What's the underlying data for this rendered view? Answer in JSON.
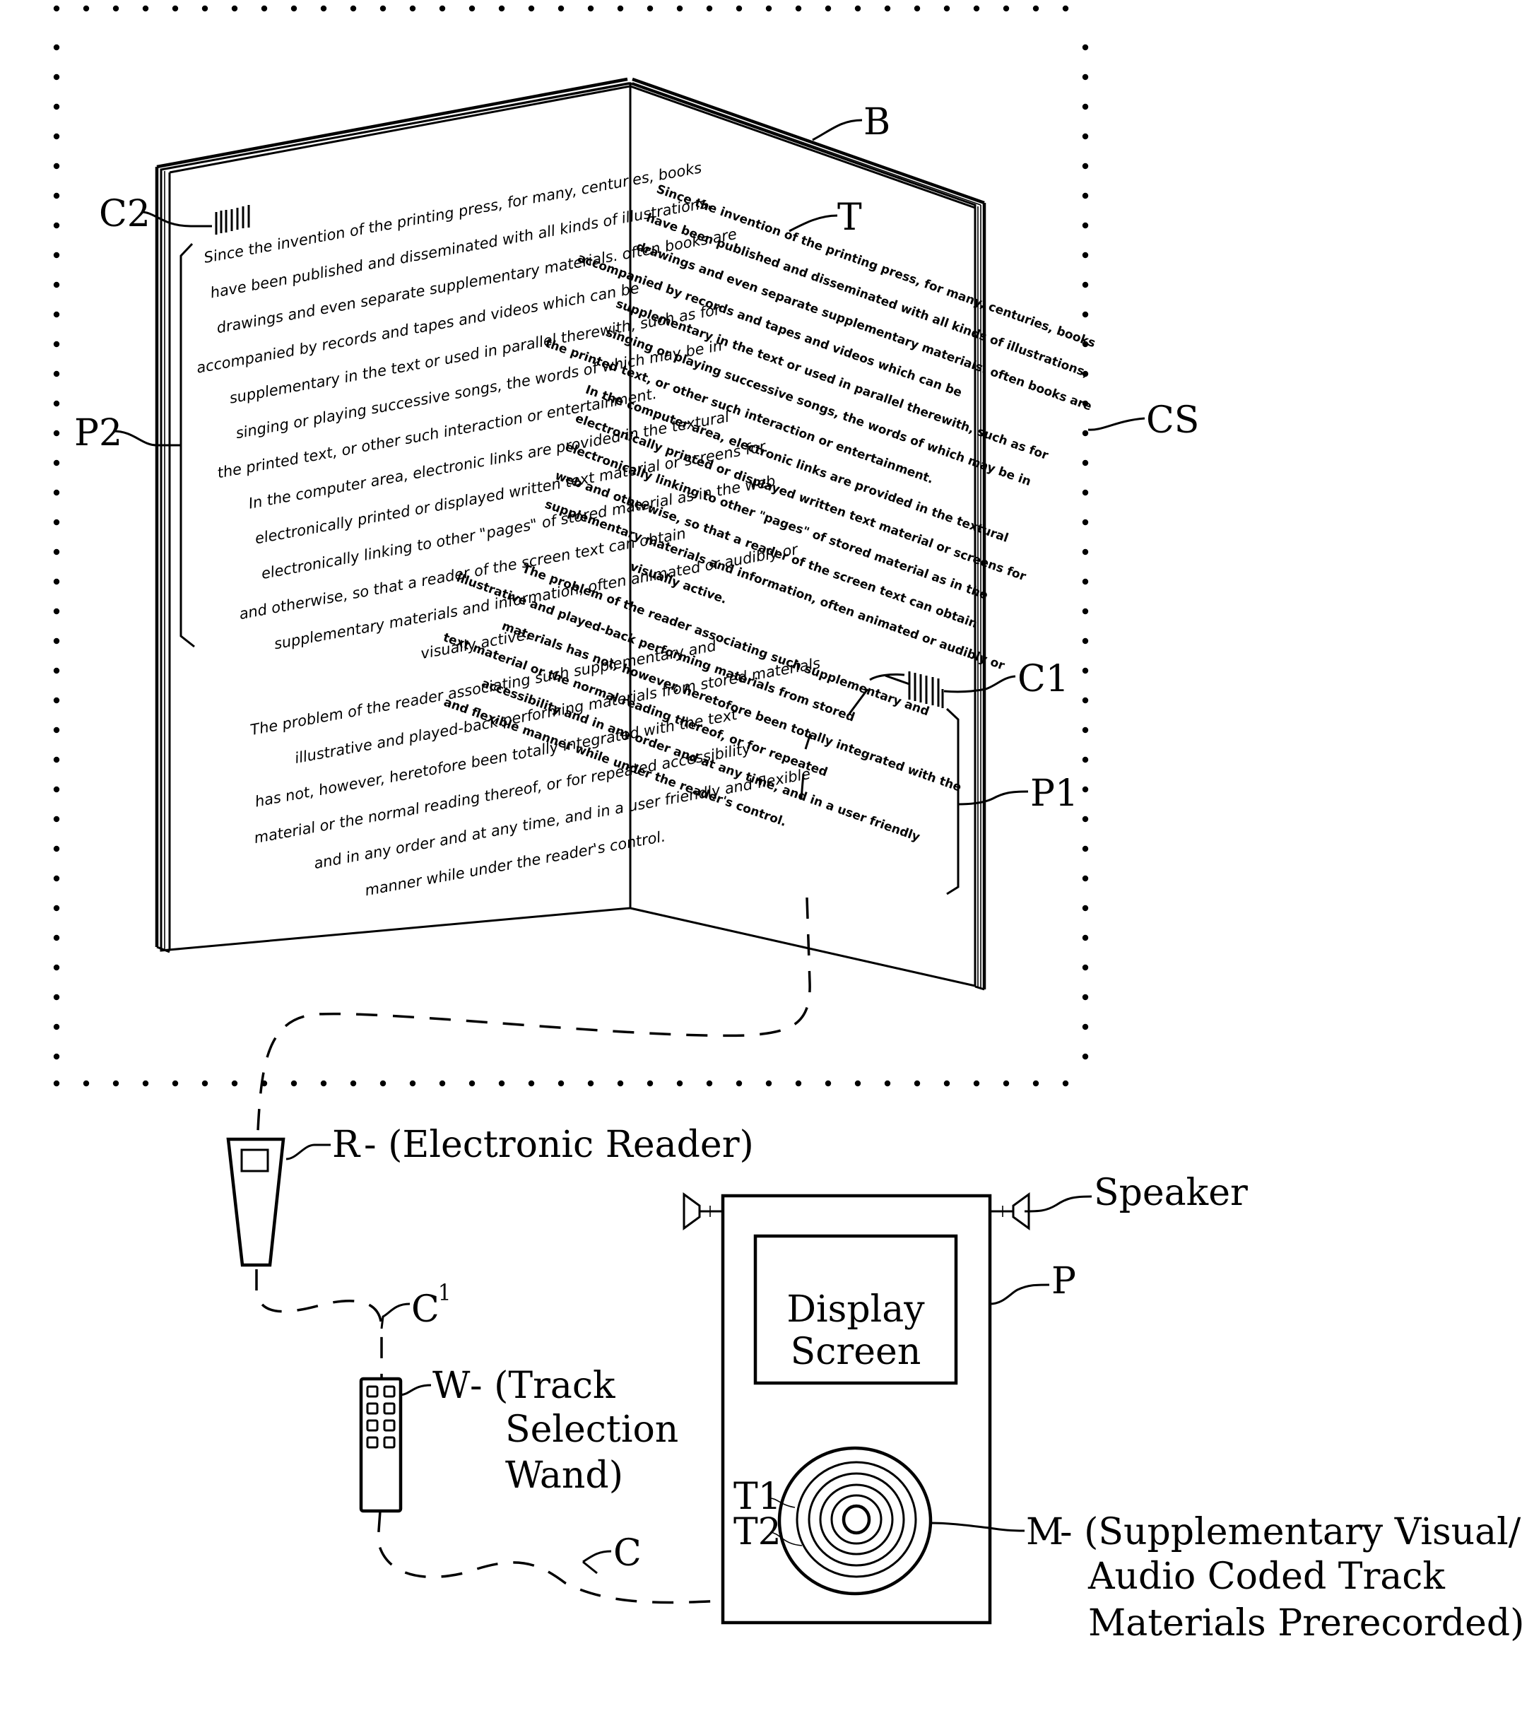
{
  "figure": {
    "system_label": "CS",
    "book": {
      "label": "B",
      "text_label": "T",
      "left_page": {
        "label": "P2",
        "code_label": "C2",
        "lines": [
          "Since the invention of the printing press, for many, centuries, books",
          "have been published and disseminated with all kinds of illustrations,",
          "drawings and even separate supplementary materials. often books are",
          "accompanied by records and tapes and videos which can be",
          "supplementary in the text or used in parallel therewith, such as for",
          "singing or playing successive songs, the words of which may be in",
          "the printed text, or other such interaction or entertainment.",
          "In the computer area, electronic links are provided in the textural",
          "electronically printed or displayed written text material or screens for",
          "electronically linking to other \"pages\" of stored material as in the web",
          "and otherwise, so that a reader of the screen text can obtain",
          "supplementary materials and information, often animated or audibly or",
          "visually active.",
          "The problem of the reader associating such supplementary and",
          "illustrative and played-back performing materials from stored materials",
          "has not, however, heretofore been totally integrated with the text",
          "material or the normal reading thereof, or for repeated accessibility",
          "and in any order and at any time, and in a user friendly and flexible",
          "manner while under the reader's control."
        ]
      },
      "right_page": {
        "label": "P1",
        "code_label": "C1",
        "lines": [
          "Since the invention of the printing press, for many, centuries, books",
          "have been published and disseminated with all kinds of illustrations,",
          "drawings and even separate supplementary materials. often books are",
          "accompanied by records and tapes and videos which can be",
          "supplementary in the text or used in parallel therewith, such as for",
          "singing or playing successive songs, the words of which may be in",
          "the printed text, or other such interaction or entertainment.",
          "In the computer area, electronic links are provided in the textural",
          "electronically printed or displayed written text material or screens for",
          "electronically linking to other \"pages\" of stored material as in the",
          "web and otherwise, so that a reader of the screen text can obtain",
          "supplementary materials and information, often animated or audibly or",
          "visually active.",
          "The problem of the reader associating such supplementary and",
          "illustrative and played-back performing materials from stored",
          "materials has not, however, heretofore been totally integrated with the",
          "text material or the normal reading thereof, or for repeated",
          "accessibility and in any order and at any time, and in a user friendly",
          "and flexible manner while under the reader's control."
        ]
      }
    },
    "reader": {
      "label": "R",
      "description": "- (Electronic Reader)"
    },
    "cable_reader_wand": {
      "label": "C",
      "superscript": "1"
    },
    "wand": {
      "label": "W",
      "description_lines": [
        "- (Track",
        "Selection",
        "Wand)"
      ],
      "button_count": 8
    },
    "cable_wand_player": {
      "label": "C"
    },
    "player": {
      "label": "P",
      "speaker_label": "Speaker",
      "screen_lines": [
        "Display",
        "Screen"
      ],
      "track1_label": "T1",
      "track2_label": "T2",
      "media": {
        "label": "M",
        "description_lines": [
          "- (Supplementary Visual/",
          "Audio Coded Track",
          "Materials Prerecorded)"
        ]
      }
    }
  }
}
